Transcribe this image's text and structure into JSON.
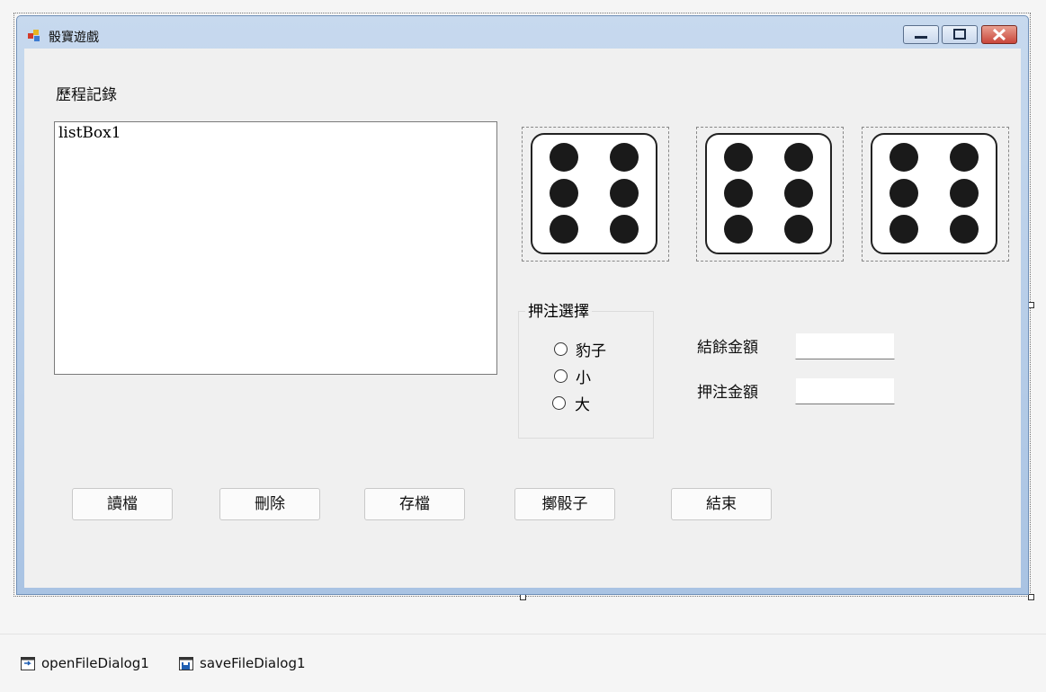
{
  "window": {
    "title": "骰寶遊戲"
  },
  "labels": {
    "history": "歷程記錄",
    "balance": "結餘金額",
    "bet_amount": "押注金額"
  },
  "listbox": {
    "text": "listBox1"
  },
  "dice": [
    6,
    6,
    6
  ],
  "bet_group": {
    "title": "押注選擇",
    "options": [
      {
        "label": "豹子",
        "checked": false
      },
      {
        "label": "小",
        "checked": false
      },
      {
        "label": "大",
        "checked": false
      }
    ]
  },
  "inputs": {
    "balance_value": "",
    "bet_value": ""
  },
  "buttons": {
    "load": "讀檔",
    "delete": "刪除",
    "save": "存檔",
    "roll": "擲骰子",
    "exit": "結束"
  },
  "tray": {
    "open_dialog": "openFileDialog1",
    "save_dialog": "saveFileDialog1"
  },
  "colors": {
    "close_button": "#c9463b",
    "title_gradient": "#a9c3e3",
    "client": "#f0f0f0"
  }
}
